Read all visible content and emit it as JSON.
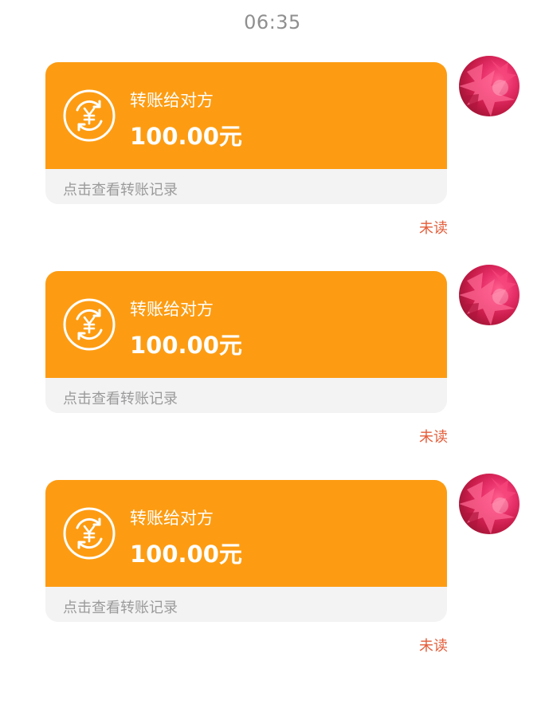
{
  "timestamp": "06:35",
  "messages": [
    {
      "label": "转账给对方",
      "amount": "100.00元",
      "record_link": "点击查看转账记录",
      "status": "未读"
    },
    {
      "label": "转账给对方",
      "amount": "100.00元",
      "record_link": "点击查看转账记录",
      "status": "未读"
    },
    {
      "label": "转账给对方",
      "amount": "100.00元",
      "record_link": "点击查看转账记录",
      "status": "未读"
    }
  ],
  "icons": {
    "transfer": "transfer-yuan-icon",
    "avatar": "user-avatar"
  },
  "colors": {
    "bubble": "#fd9c12",
    "bubble_footer": "#f3f3f4",
    "status_text": "#e35d3a",
    "timestamp_text": "#8f8f8f"
  }
}
